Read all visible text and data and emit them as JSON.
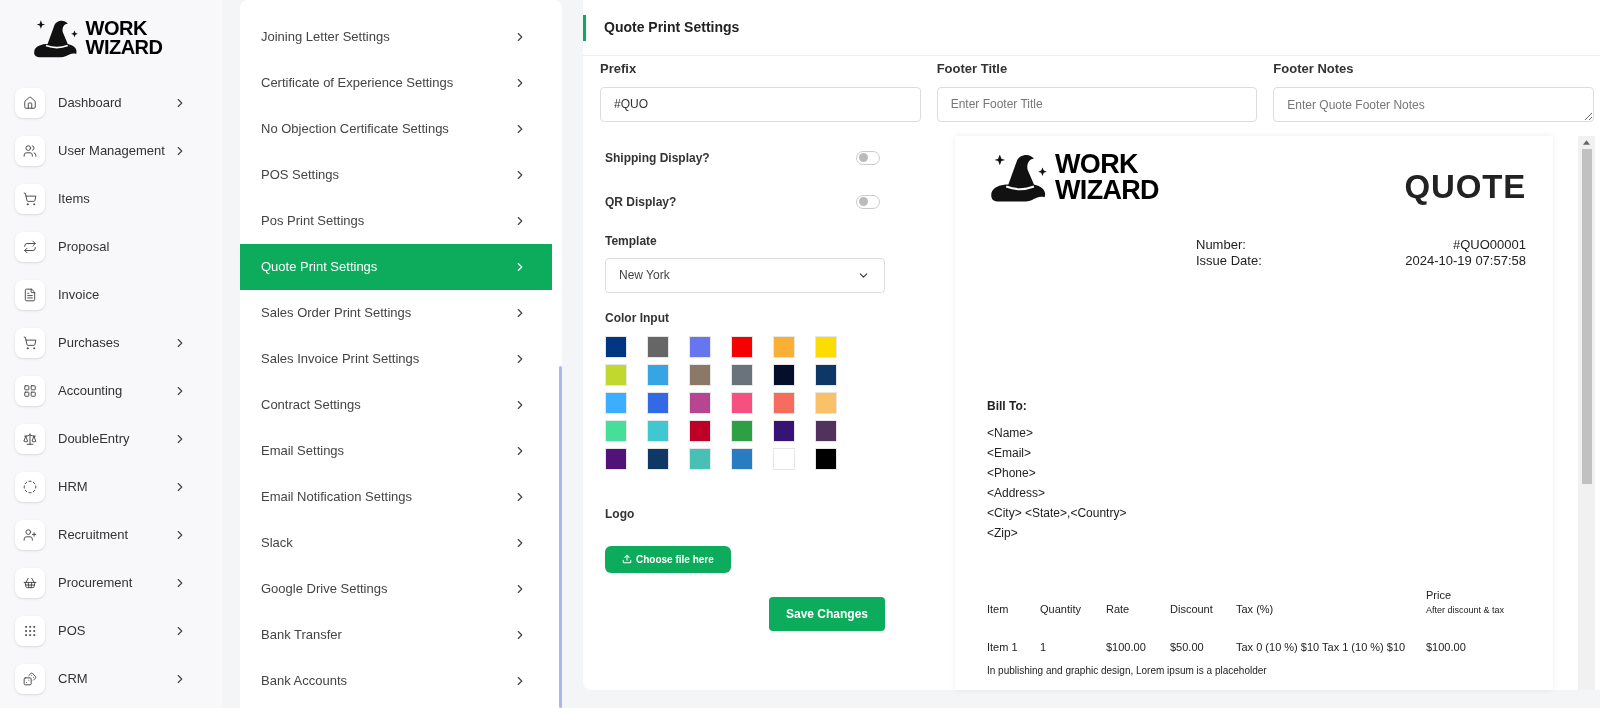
{
  "brand": {
    "line1": "WORK",
    "line2": "WIZARD"
  },
  "sidebar": {
    "items": [
      {
        "label": "Dashboard",
        "has_submenu": true
      },
      {
        "label": "User Management",
        "has_submenu": true
      },
      {
        "label": "Items",
        "has_submenu": false
      },
      {
        "label": "Proposal",
        "has_submenu": false
      },
      {
        "label": "Invoice",
        "has_submenu": false
      },
      {
        "label": "Purchases",
        "has_submenu": true
      },
      {
        "label": "Accounting",
        "has_submenu": true
      },
      {
        "label": "DoubleEntry",
        "has_submenu": true
      },
      {
        "label": "HRM",
        "has_submenu": true
      },
      {
        "label": "Recruitment",
        "has_submenu": true
      },
      {
        "label": "Procurement",
        "has_submenu": true
      },
      {
        "label": "POS",
        "has_submenu": true
      },
      {
        "label": "CRM",
        "has_submenu": true
      }
    ]
  },
  "settings_menu": {
    "items": [
      {
        "label": "Joining Letter Settings",
        "selected": false
      },
      {
        "label": "Certificate of Experience Settings",
        "selected": false
      },
      {
        "label": "No Objection Certificate Settings",
        "selected": false
      },
      {
        "label": "POS Settings",
        "selected": false
      },
      {
        "label": "Pos Print Settings",
        "selected": false
      },
      {
        "label": "Quote Print Settings",
        "selected": true
      },
      {
        "label": "Sales Order Print Settings",
        "selected": false
      },
      {
        "label": "Sales Invoice Print Settings",
        "selected": false
      },
      {
        "label": "Contract Settings",
        "selected": false
      },
      {
        "label": "Email Settings",
        "selected": false
      },
      {
        "label": "Email Notification Settings",
        "selected": false
      },
      {
        "label": "Slack",
        "selected": false
      },
      {
        "label": "Google Drive Settings",
        "selected": false
      },
      {
        "label": "Bank Transfer",
        "selected": false
      },
      {
        "label": "Bank Accounts",
        "selected": false
      }
    ]
  },
  "panel": {
    "title": "Quote Print Settings"
  },
  "fields": [
    {
      "kind": "input",
      "label": "Prefix",
      "value": "#QUO"
    },
    {
      "kind": "input",
      "label": "Footer Title",
      "placeholder": "Enter Footer Title"
    },
    {
      "kind": "textarea",
      "label": "Footer Notes",
      "placeholder": "Enter Quote Footer Notes"
    }
  ],
  "toggles": [
    {
      "label": "Shipping Display?",
      "on": false
    },
    {
      "label": "QR Display?",
      "on": false
    }
  ],
  "template": {
    "label": "Template",
    "value": "New York"
  },
  "color_input": {
    "label": "Color Input",
    "swatches": [
      {
        "color": "#003580"
      },
      {
        "color": "#666666"
      },
      {
        "color": "#6676ef"
      },
      {
        "color": "#f50102"
      },
      {
        "color": "#f9b034"
      },
      {
        "color": "#fbdd03"
      },
      {
        "color": "#c1d82f"
      },
      {
        "color": "#37a4e4"
      },
      {
        "color": "#8a7966"
      },
      {
        "color": "#6a737b"
      },
      {
        "color": "#050f2c"
      },
      {
        "color": "#0e3666"
      },
      {
        "color": "#3baeff"
      },
      {
        "color": "#3368e6"
      },
      {
        "color": "#b84592"
      },
      {
        "color": "#f64f81"
      },
      {
        "color": "#f66c5f"
      },
      {
        "color": "#fac168"
      },
      {
        "color": "#46de98"
      },
      {
        "color": "#40c7d0"
      },
      {
        "color": "#be0028"
      },
      {
        "color": "#2f9f45"
      },
      {
        "color": "#371474"
      },
      {
        "color": "#52325d"
      },
      {
        "color": "#511378"
      },
      {
        "color": "#0f3866"
      },
      {
        "color": "#48c0b6"
      },
      {
        "color": "#297cc0"
      },
      {
        "color": "#ffffff"
      },
      {
        "color": "#000000"
      }
    ]
  },
  "logo": {
    "label": "Logo",
    "button": "Choose file here"
  },
  "save_button": "Save Changes",
  "preview": {
    "brand": {
      "line1": "WORK",
      "line2": "WIZARD"
    },
    "title": "QUOTE",
    "meta": [
      {
        "label": "Number:",
        "value": "#QUO00001"
      },
      {
        "label": "Issue Date:",
        "value": "2024-10-19 07:57:58"
      }
    ],
    "bill_to": {
      "title": "Bill To:",
      "lines": [
        "<Name>",
        "<Email>",
        "<Phone>",
        "<Address>",
        "<City> <State>,<Country>",
        "<Zip>"
      ]
    },
    "columns": [
      {
        "label": "Item"
      },
      {
        "label": "Quantity"
      },
      {
        "label": "Rate"
      },
      {
        "label": "Discount"
      },
      {
        "label": "Tax (%)"
      },
      {
        "label": "Price",
        "sublabel": "After discount & tax"
      }
    ],
    "rows": [
      {
        "cells": [
          "Item 1",
          "1",
          "$100.00",
          "$50.00",
          "Tax 0 (10 %) $10 Tax 1 (10 %) $10",
          "$100.00"
        ],
        "description": "In publishing and graphic design, Lorem ipsum is a placeholder"
      }
    ]
  }
}
